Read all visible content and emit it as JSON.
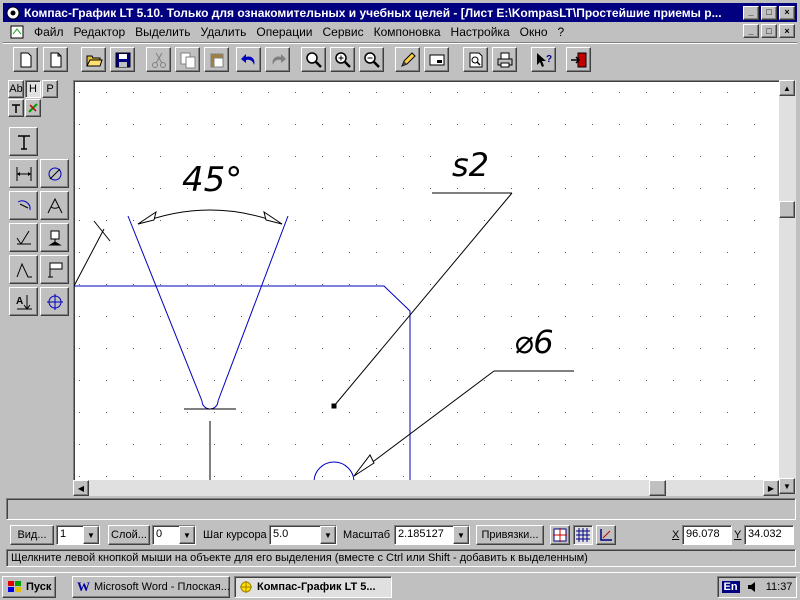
{
  "window": {
    "title": "Компас-График LT 5.10. Только для ознакомительных и учебных целей - [Лист E:\\KompasLT\\Простейшие приемы р...",
    "caption_minimize": "_",
    "caption_maximize": "□",
    "caption_close": "×"
  },
  "menu": {
    "items": [
      "Файл",
      "Редактор",
      "Выделить",
      "Удалить",
      "Операции",
      "Сервис",
      "Компоновка",
      "Настройка",
      "Окно",
      "?"
    ]
  },
  "left_panel": {
    "tabs": [
      "Ab",
      "H",
      "P"
    ]
  },
  "drawing": {
    "angle_label": "45°",
    "roughness_label": "s2",
    "diameter_label": "⌀6"
  },
  "params": {
    "view_button": "Вид...",
    "view_value": "1",
    "layer_button": "Слой...",
    "layer_value": "0",
    "step_label": "Шаг курсора",
    "step_value": "5.0",
    "scale_label": "Масштаб",
    "scale_value": "2.185127",
    "snap_button": "Привязки...",
    "x_label": "X",
    "x_value": "96.078",
    "y_label": "Y",
    "y_value": "34.032"
  },
  "status": {
    "hint": "Щелкните левой кнопкой мыши на объекте для его выделения (вместе с Ctrl или Shift - добавить к выделенным)"
  },
  "taskbar": {
    "start_label": "Пуск",
    "tasks": [
      "Microsoft Word - Плоская...",
      "Компас-График LT 5..."
    ],
    "lang": "En",
    "time": "11:37"
  },
  "colors": {
    "titlebar": "#000080",
    "geometry": "#0000c0",
    "dimension": "#000000"
  }
}
